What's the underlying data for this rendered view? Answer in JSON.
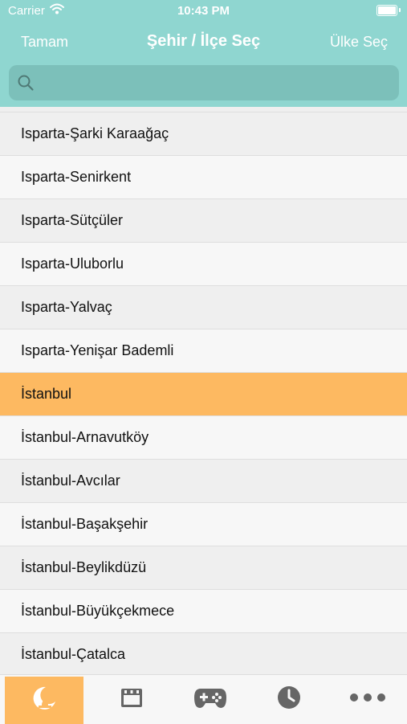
{
  "status_bar": {
    "carrier": "Carrier",
    "time": "10:43 PM"
  },
  "nav": {
    "left_button": "Tamam",
    "title": "Şehir / İlçe Seç",
    "right_button": "Ülke Seç"
  },
  "search": {
    "value": "",
    "placeholder": ""
  },
  "list": {
    "selected_index": 6,
    "items": [
      "Isparta-Şarki Karaağaç",
      "Isparta-Senirkent",
      "Isparta-Sütçüler",
      "Isparta-Uluborlu",
      "Isparta-Yalvaç",
      "Isparta-Yenişar Bademli",
      "İstanbul",
      "İstanbul-Arnavutköy",
      "İstanbul-Avcılar",
      "İstanbul-Başakşehir",
      "İstanbul-Beylikdüzü",
      "İstanbul-Büyükçekmece",
      "İstanbul-Çatalca"
    ]
  },
  "tabbar": {
    "active_index": 0,
    "tabs": [
      {
        "icon": "mosque-moon-icon"
      },
      {
        "icon": "calendar-icon"
      },
      {
        "icon": "gamepad-icon"
      },
      {
        "icon": "clock-icon"
      },
      {
        "icon": "more-icon"
      }
    ]
  },
  "colors": {
    "header": "#8fd6d0",
    "search_field": "#7cc0ba",
    "selected_row": "#fdb961",
    "tab_icon": "#666666"
  }
}
